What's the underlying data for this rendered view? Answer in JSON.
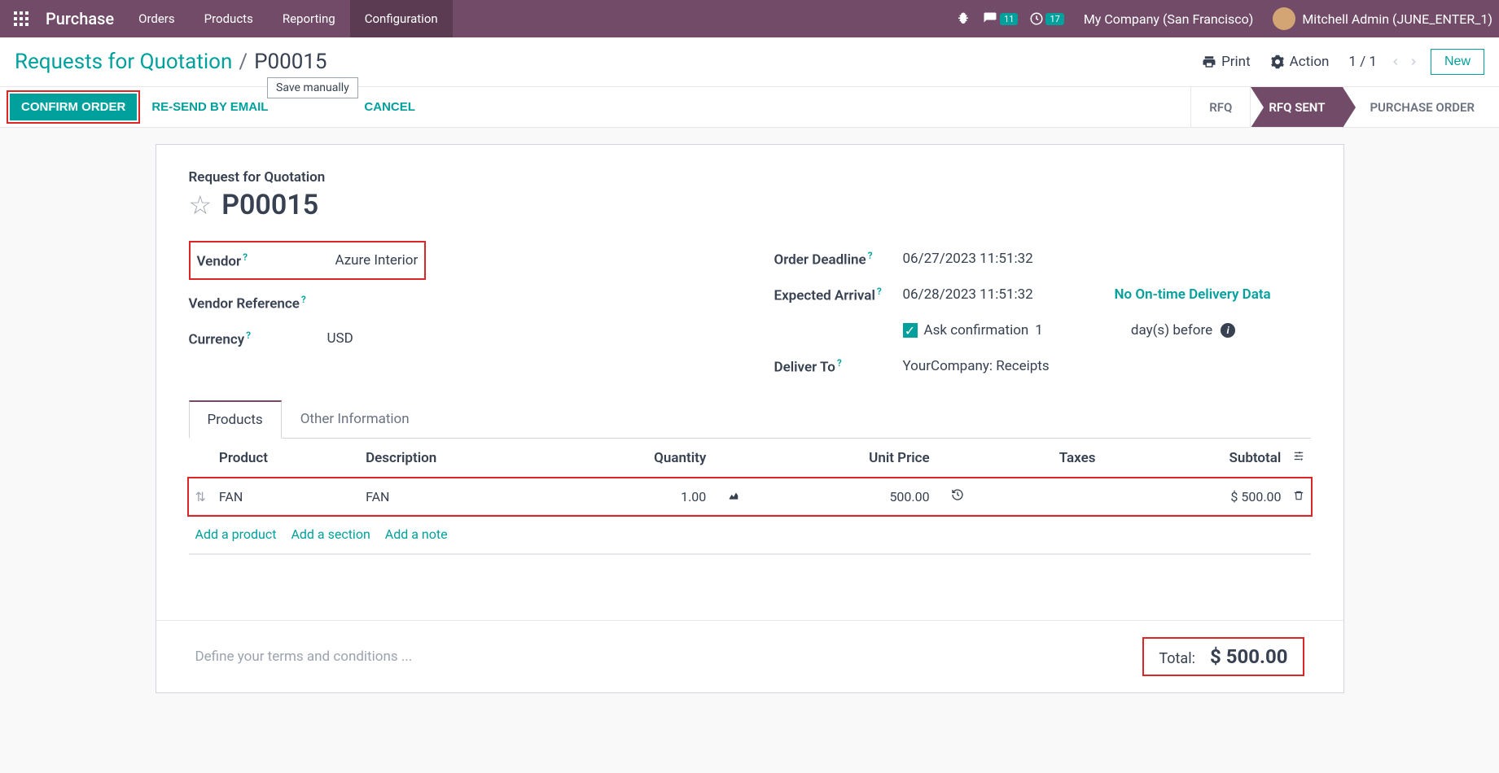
{
  "topnav": {
    "app": "Purchase",
    "menu": [
      "Orders",
      "Products",
      "Reporting",
      "Configuration"
    ],
    "active_menu": 3,
    "messages_count": "11",
    "activities_count": "17",
    "company": "My Company (San Francisco)",
    "user": "Mitchell Admin (JUNE_ENTER_1)"
  },
  "breadcrumb": {
    "parent": "Requests for Quotation",
    "current": "P00015",
    "print": "Print",
    "action": "Action",
    "pager": "1 / 1",
    "new": "New"
  },
  "tooltip": "Save manually",
  "buttons": {
    "confirm": "CONFIRM ORDER",
    "resend": "RE-SEND BY EMAIL",
    "cancel": "CANCEL"
  },
  "status_steps": {
    "rfq": "RFQ",
    "rfq_sent": "RFQ SENT",
    "po": "PURCHASE ORDER"
  },
  "document": {
    "subtitle": "Request for Quotation",
    "name": "P00015"
  },
  "fields": {
    "vendor_label": "Vendor",
    "vendor_value": "Azure Interior",
    "vendor_ref_label": "Vendor Reference",
    "currency_label": "Currency",
    "currency_value": "USD",
    "deadline_label": "Order Deadline",
    "deadline_value": "06/27/2023 11:51:32",
    "expected_label": "Expected Arrival",
    "expected_value": "06/28/2023 11:51:32",
    "ontime_link": "No On-time Delivery Data",
    "ask_label": "Ask confirmation",
    "ask_days": "1",
    "ask_suffix": "day(s) before",
    "deliver_label": "Deliver To",
    "deliver_value": "YourCompany: Receipts"
  },
  "tabs": {
    "products": "Products",
    "other": "Other Information"
  },
  "table": {
    "headers": {
      "product": "Product",
      "description": "Description",
      "quantity": "Quantity",
      "unit_price": "Unit Price",
      "taxes": "Taxes",
      "subtotal": "Subtotal"
    },
    "row": {
      "product": "FAN",
      "description": "FAN",
      "quantity": "1.00",
      "unit_price": "500.00",
      "subtotal": "$ 500.00"
    },
    "add_product": "Add a product",
    "add_section": "Add a section",
    "add_note": "Add a note"
  },
  "terms_placeholder": "Define your terms and conditions ...",
  "total": {
    "label": "Total:",
    "value": "$ 500.00"
  }
}
